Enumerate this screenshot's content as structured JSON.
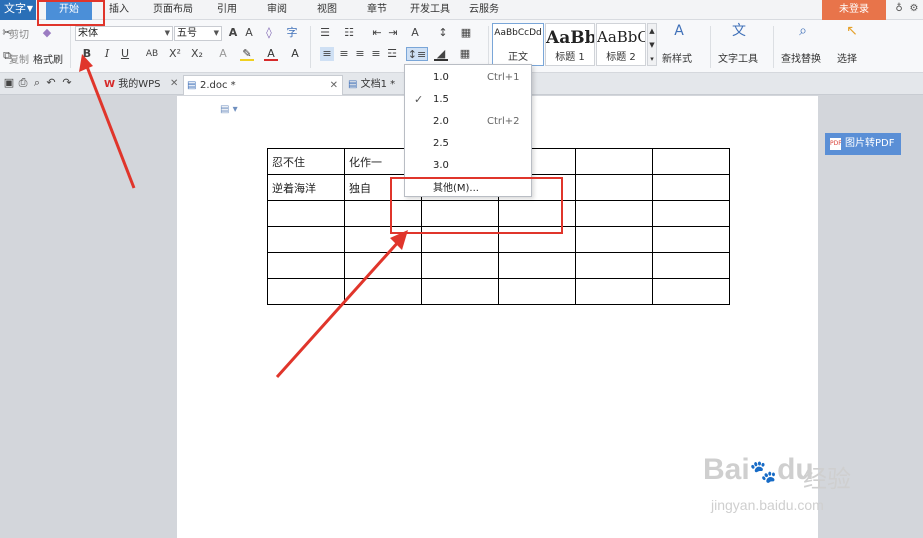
{
  "menubar": {
    "app_label": "文字",
    "tabs": [
      "开始",
      "插入",
      "页面布局",
      "引用",
      "审阅",
      "视图",
      "章节",
      "开发工具",
      "云服务"
    ],
    "login_label": "未登录"
  },
  "ribbon": {
    "clipboard": {
      "cut": "剪切",
      "copy": "复制",
      "format_painter": "格式刷"
    },
    "font_name": "宋体",
    "font_size": "五号",
    "styles": [
      {
        "sample": "AaBbCcDd",
        "label": "正文"
      },
      {
        "sample": "AaBb",
        "label": "标题 1"
      },
      {
        "sample": "AaBbC",
        "label": "标题 2"
      }
    ],
    "new_style": "新样式",
    "text_tools": "文字工具",
    "find_replace": "查找替换",
    "select": "选择"
  },
  "tabstrip": {
    "my_wps": "我的WPS",
    "active_doc": "2.doc *",
    "other_doc": "文档1 *"
  },
  "table": {
    "rows": [
      [
        "忍不住",
        "化作一",
        "",
        "",
        "",
        ""
      ],
      [
        "逆着海洋",
        "独自",
        "",
        "",
        "",
        ""
      ],
      [
        "",
        "",
        "",
        "",
        "",
        ""
      ],
      [
        "",
        "",
        "",
        "",
        "",
        ""
      ],
      [
        "",
        "",
        "",
        "",
        "",
        ""
      ],
      [
        "",
        "",
        "",
        "",
        "",
        ""
      ]
    ]
  },
  "line_spacing_menu": {
    "items": [
      {
        "value": "1.0",
        "shortcut": "Ctrl+1",
        "checked": false
      },
      {
        "value": "1.5",
        "shortcut": "",
        "checked": true
      },
      {
        "value": "2.0",
        "shortcut": "Ctrl+2",
        "checked": false
      },
      {
        "value": "2.5",
        "shortcut": "",
        "checked": false
      },
      {
        "value": "3.0",
        "shortcut": "",
        "checked": false
      }
    ],
    "other_label": "其他(M)..."
  },
  "pdf_button": {
    "label": "图片转PDF"
  },
  "watermark": {
    "logo": "Bai",
    "logo2": "du",
    "text": "经验",
    "url": "jingyan.baidu.com"
  },
  "colors": {
    "annotation": "#e0352b",
    "accent": "#2a6fb7",
    "login": "#e8744a"
  }
}
